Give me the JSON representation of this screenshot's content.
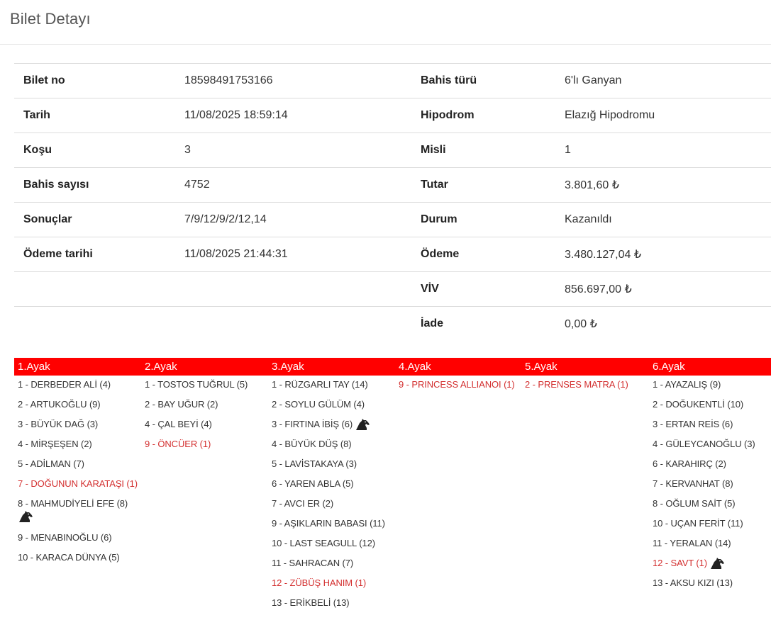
{
  "page": {
    "title": "Bilet Detayı"
  },
  "details": {
    "rows": [
      {
        "l1": "Bilet no",
        "v1": "18598491753166",
        "l2": "Bahis türü",
        "v2": "6'lı Ganyan"
      },
      {
        "l1": "Tarih",
        "v1": "11/08/2025 18:59:14",
        "l2": "Hipodrom",
        "v2": "Elazığ Hipodromu"
      },
      {
        "l1": "Koşu",
        "v1": "3",
        "l2": "Misli",
        "v2": "1"
      },
      {
        "l1": "Bahis sayısı",
        "v1": "4752",
        "l2": "Tutar",
        "v2": "3.801,60 ₺"
      },
      {
        "l1": "Sonuçlar",
        "v1": "7/9/12/9/2/12,14",
        "l2": "Durum",
        "v2": "Kazanıldı"
      },
      {
        "l1": "Ödeme tarihi",
        "v1": "11/08/2025 21:44:31",
        "l2": "Ödeme",
        "v2": "3.480.127,04 ₺"
      },
      {
        "l1": "",
        "v1": "",
        "l2": "VİV",
        "v2": "856.697,00 ₺"
      },
      {
        "l1": "",
        "v1": "",
        "l2": "İade",
        "v2": "0,00 ₺"
      }
    ]
  },
  "legs": [
    {
      "title": "1.Ayak",
      "runners": [
        {
          "text": "1 - DERBEDER ALİ (4)",
          "win": false,
          "icon": null
        },
        {
          "text": "2 - ARTUKOĞLU (9)",
          "win": false,
          "icon": null
        },
        {
          "text": "3 - BÜYÜK DAĞ (3)",
          "win": false,
          "icon": null
        },
        {
          "text": "4 - MİRŞEŞEN (2)",
          "win": false,
          "icon": null
        },
        {
          "text": "5 - ADİLMAN (7)",
          "win": false,
          "icon": null
        },
        {
          "text": "7 - DOĞUNUN KARATAŞI (1)",
          "win": true,
          "icon": null
        },
        {
          "text": "8 - MAHMUDİYELİ EFE (8)",
          "win": false,
          "icon": "horse-head-icon"
        },
        {
          "text": "9 - MENABINOĞLU (6)",
          "win": false,
          "icon": null
        },
        {
          "text": "10 - KARACA DÜNYA (5)",
          "win": false,
          "icon": null
        }
      ]
    },
    {
      "title": "2.Ayak",
      "runners": [
        {
          "text": "1 - TOSTOS TUĞRUL (5)",
          "win": false,
          "icon": null
        },
        {
          "text": "2 - BAY UĞUR (2)",
          "win": false,
          "icon": null
        },
        {
          "text": "4 - ÇAL BEYİ (4)",
          "win": false,
          "icon": null
        },
        {
          "text": "9 - ÖNCÜER (1)",
          "win": true,
          "icon": null
        }
      ]
    },
    {
      "title": "3.Ayak",
      "runners": [
        {
          "text": "1 - RÜZGARLI TAY (14)",
          "win": false,
          "icon": null
        },
        {
          "text": "2 - SOYLU GÜLÜM (4)",
          "win": false,
          "icon": null
        },
        {
          "text": "3 - FIRTINA İBİŞ (6)",
          "win": false,
          "icon": "horse-head-icon"
        },
        {
          "text": "4 - BÜYÜK DÜŞ (8)",
          "win": false,
          "icon": null
        },
        {
          "text": "5 - LAVİSTAKAYA (3)",
          "win": false,
          "icon": null
        },
        {
          "text": "6 - YAREN ABLA (5)",
          "win": false,
          "icon": null
        },
        {
          "text": "7 - AVCI ER (2)",
          "win": false,
          "icon": null
        },
        {
          "text": "9 - AŞIKLARIN BABASI (11)",
          "win": false,
          "icon": null
        },
        {
          "text": "10 - LAST SEAGULL (12)",
          "win": false,
          "icon": null
        },
        {
          "text": "11 - SAHRACAN (7)",
          "win": false,
          "icon": null
        },
        {
          "text": "12 - ZÜBÜŞ HANIM (1)",
          "win": true,
          "icon": null
        },
        {
          "text": "13 - ERİKBELİ (13)",
          "win": false,
          "icon": null
        }
      ]
    },
    {
      "title": "4.Ayak",
      "runners": [
        {
          "text": "9 - PRINCESS ALLIANOI (1)",
          "win": true,
          "icon": null
        }
      ]
    },
    {
      "title": "5.Ayak",
      "runners": [
        {
          "text": "2 - PRENSES MATRA (1)",
          "win": true,
          "icon": null
        }
      ]
    },
    {
      "title": "6.Ayak",
      "runners": [
        {
          "text": "1 - AYAZALIŞ (9)",
          "win": false,
          "icon": null
        },
        {
          "text": "2 - DOĞUKENTLİ (10)",
          "win": false,
          "icon": null
        },
        {
          "text": "3 - ERTAN REİS (6)",
          "win": false,
          "icon": null
        },
        {
          "text": "4 - GÜLEYCANOĞLU (3)",
          "win": false,
          "icon": null
        },
        {
          "text": "6 - KARAHIRÇ (2)",
          "win": false,
          "icon": null
        },
        {
          "text": "7 - KERVANHAT (8)",
          "win": false,
          "icon": null
        },
        {
          "text": "8 - OĞLUM SAİT (5)",
          "win": false,
          "icon": null
        },
        {
          "text": "10 - UÇAN FERİT (11)",
          "win": false,
          "icon": null
        },
        {
          "text": "11 - YERALAN (14)",
          "win": false,
          "icon": null
        },
        {
          "text": "12 - SAVT (1)",
          "win": true,
          "icon": "horse-head-icon"
        },
        {
          "text": "13 - AKSU KIZI (13)",
          "win": false,
          "icon": null
        }
      ]
    }
  ],
  "colors": {
    "accent": "#ff0000",
    "win_text": "#d32f2f"
  }
}
